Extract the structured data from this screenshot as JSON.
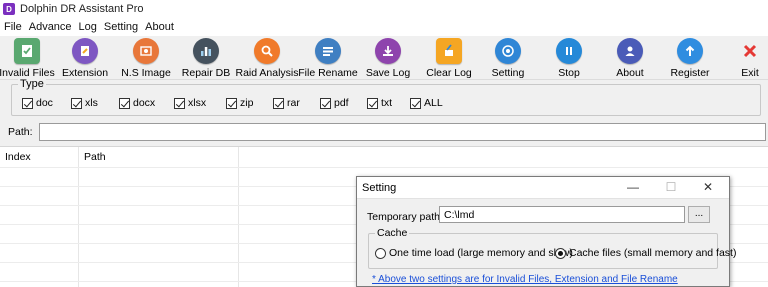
{
  "window": {
    "title": "Dolphin DR Assistant Pro"
  },
  "menu": [
    "File",
    "Advance",
    "Log",
    "Setting",
    "About"
  ],
  "toolbar": [
    {
      "label": "Invalid Files",
      "icon": "invalid-files-icon",
      "color": "#5aa870"
    },
    {
      "label": "Extension",
      "icon": "extension-icon",
      "color": "#7e57c2"
    },
    {
      "label": "N.S Image",
      "icon": "image-icon",
      "color": "#e8773a"
    },
    {
      "label": "Repair DB",
      "icon": "database-icon",
      "color": "#45525e"
    },
    {
      "label": "Raid Analysis",
      "icon": "search-icon",
      "color": "#f07a2a"
    },
    {
      "label": "File Rename",
      "icon": "file-rename-icon",
      "color": "#3f7fc2"
    },
    {
      "label": "Save Log",
      "icon": "save-log-icon",
      "color": "#8e44ad"
    },
    {
      "label": "Clear Log",
      "icon": "clear-log-icon",
      "color": "#f5a623"
    },
    {
      "label": "Setting",
      "icon": "gear-icon",
      "color": "#2f86d6"
    },
    {
      "label": "Stop",
      "icon": "pause-icon",
      "color": "#2589d8"
    },
    {
      "label": "About",
      "icon": "user-icon",
      "color": "#4a5bb8"
    },
    {
      "label": "Register",
      "icon": "arrow-up-icon",
      "color": "#2f8de0"
    },
    {
      "label": "Exit",
      "icon": "close-icon",
      "color": "#e53935"
    }
  ],
  "type_group": {
    "legend": "Type",
    "options": [
      "doc",
      "xls",
      "docx",
      "xlsx",
      "zip",
      "rar",
      "pdf",
      "txt",
      "ALL"
    ]
  },
  "path": {
    "label": "Path:",
    "value": ""
  },
  "table": {
    "columns": [
      "Index",
      "Path"
    ]
  },
  "dialog": {
    "title": "Setting",
    "minimize": "—",
    "maximize": "☐",
    "close": "✕",
    "temp_path_label": "Temporary path:",
    "temp_path_value": "C:\\lmd",
    "browse_label": "...",
    "cache_legend": "Cache",
    "option_one_time": "One time load (large memory and slow)",
    "option_cache_files": "Cache files (small memory and fast)",
    "selected_option": "Cache files (small memory and fast)",
    "note": "* Above two settings are for Invalid Files, Extension and File Rename"
  }
}
